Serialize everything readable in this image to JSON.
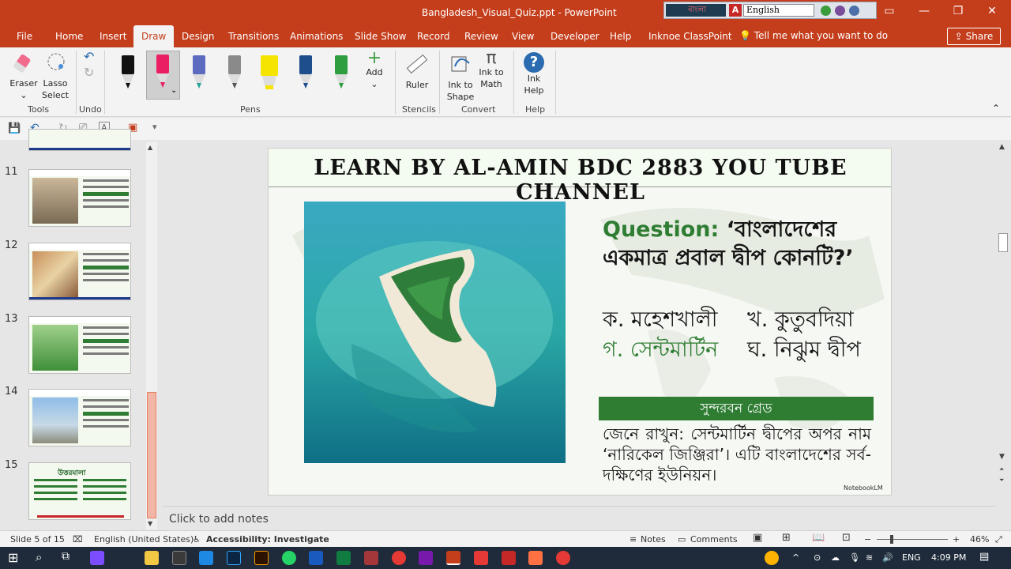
{
  "window": {
    "title": "Bangladesh_Visual_Quiz.ppt - PowerPoint",
    "lang_widget": {
      "bangla_label": "বাংলা",
      "input_lang": "English"
    }
  },
  "menu": {
    "tabs": [
      "File",
      "Home",
      "Insert",
      "Draw",
      "Design",
      "Transitions",
      "Animations",
      "Slide Show",
      "Record",
      "Review",
      "View",
      "Developer",
      "Help",
      "Inknoe ClassPoint"
    ],
    "active": "Draw",
    "tell_me": "Tell me what you want to do",
    "share": "Share"
  },
  "ribbon": {
    "tools": {
      "eraser": "Eraser",
      "lasso_1": "Lasso",
      "lasso_2": "Select",
      "group": "Tools"
    },
    "undo_group": "Undo",
    "pens_group": "Pens",
    "add": "Add",
    "stencils": {
      "ruler": "Ruler",
      "group": "Stencils"
    },
    "convert": {
      "ink_shape_1": "Ink to",
      "ink_shape_2": "Shape",
      "ink_math_1": "Ink to",
      "ink_math_2": "Math",
      "group": "Convert"
    },
    "help": {
      "ink_help_1": "Ink",
      "ink_help_2": "Help",
      "group": "Help"
    }
  },
  "thumbnails": [
    {
      "num": "11"
    },
    {
      "num": "12"
    },
    {
      "num": "13"
    },
    {
      "num": "14"
    },
    {
      "num": "15",
      "heading": "উত্তরমালা"
    }
  ],
  "slide": {
    "header": "LEARN BY AL-AMIN BDC 2883 YOU TUBE CHANNEL",
    "question_label": "Question:",
    "question_text": "‘বাংলাদেশের একমাত্র প্রবাল দ্বীপ কোনটি?’",
    "options": {
      "a": "ক. মহেশখালী",
      "b": "খ. কুতুবদিয়া",
      "c": "গ. সেন্টমার্টিন",
      "d": "ঘ. নিঝুম দ্বীপ"
    },
    "group_label": "সুন্দরবন গ্রেড",
    "note": "জেনে রাখুন: সেন্টমার্টিন দ্বীপের অপর নাম ‘নারিকেল জিঞ্জিরা’। এটি বাংলাদেশের সর্ব-দক্ষিণের ইউনিয়ন।",
    "watermark": "NotebookLM"
  },
  "notes_placeholder": "Click to add notes",
  "status": {
    "slide": "Slide 5 of 15",
    "language": "English (United States)",
    "accessibility": "Accessibility: Investigate",
    "notes": "Notes",
    "comments": "Comments",
    "zoom": "46%"
  },
  "taskbar": {
    "lang": "ENG",
    "time": "4:09 PM"
  },
  "colors": {
    "accent": "#c43e1c",
    "green": "#2e7d32"
  }
}
